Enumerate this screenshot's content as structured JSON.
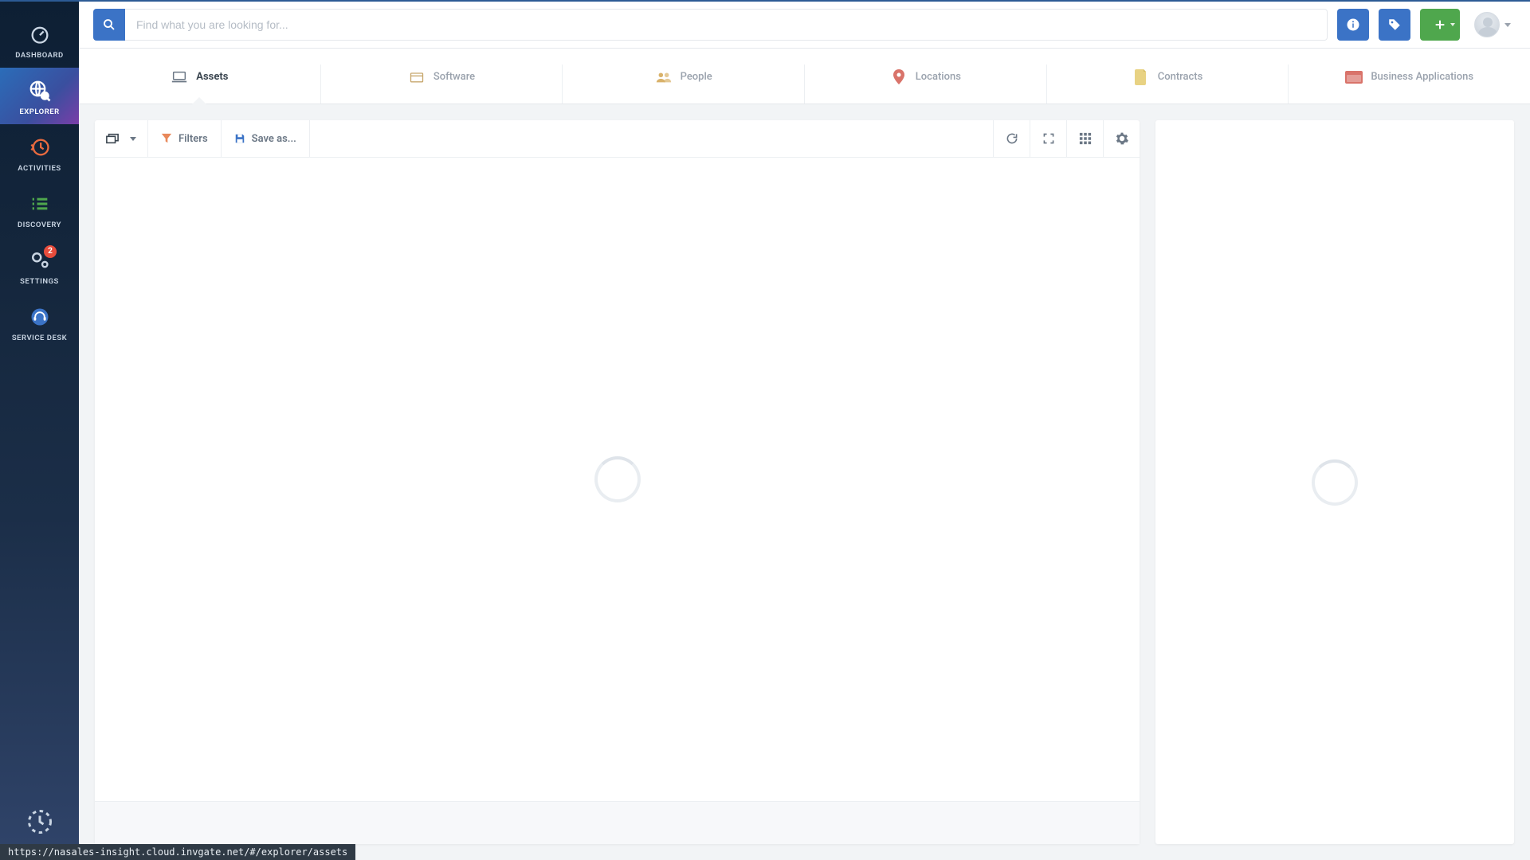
{
  "sidebar": {
    "items": [
      {
        "label": "DASHBOARD"
      },
      {
        "label": "EXPLORER"
      },
      {
        "label": "ACTIVITIES"
      },
      {
        "label": "DISCOVERY"
      },
      {
        "label": "SETTINGS",
        "badge": "2"
      },
      {
        "label": "SERVICE DESK"
      }
    ]
  },
  "header": {
    "search_placeholder": "Find what you are looking for..."
  },
  "tabs": [
    {
      "label": "Assets"
    },
    {
      "label": "Software"
    },
    {
      "label": "People"
    },
    {
      "label": "Locations"
    },
    {
      "label": "Contracts"
    },
    {
      "label": "Business Applications"
    }
  ],
  "toolbar": {
    "filters_label": "Filters",
    "save_as_label": "Save as..."
  },
  "status_url": "https://nasales-insight.cloud.invgate.net/#/explorer/assets"
}
